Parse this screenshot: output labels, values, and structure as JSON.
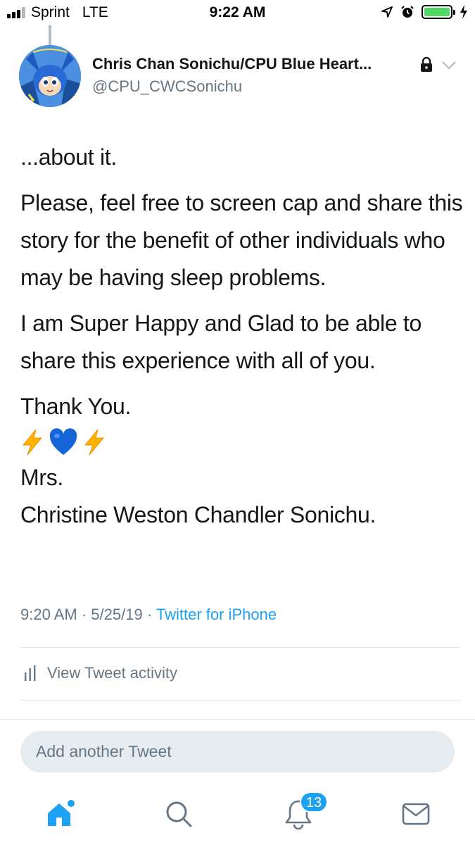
{
  "status_bar": {
    "carrier": "Sprint",
    "network": "LTE",
    "time": "9:22 AM",
    "battery_level": 1.0,
    "battery_color": "#4cd964"
  },
  "tweet": {
    "author_name": "Chris Chan Sonichu/CPU Blue Heart...",
    "author_handle": "@CPU_CWCSonichu",
    "avatar_icon": "avatar-icon",
    "paragraphs": {
      "p1": "...about it.",
      "p2": "Please, feel free to screen cap and share this story for the benefit of other individuals who may be having sleep problems.",
      "p3": "I am Super Happy and Glad to be able to share this experience with all of you.",
      "p4_line1": "Thank You.",
      "p4_emoji": [
        "high-voltage-emoji",
        "blue-heart-emoji",
        "high-voltage-emoji"
      ],
      "p4_line2": "Mrs.",
      "p4_line3": "Christine Weston Chandler Sonichu."
    },
    "timestamp_time": "9:20 AM",
    "timestamp_date": "5/25/19",
    "separator": "·",
    "source": "Twitter for iPhone"
  },
  "activity": {
    "label": "View Tweet activity",
    "icon": "bar-chart-icon"
  },
  "reply": {
    "placeholder": "Add another Tweet"
  },
  "tab_bar": {
    "items": [
      "home-icon",
      "search-icon",
      "notifications-icon",
      "messages-icon"
    ],
    "notifications_badge": "13",
    "active_color": "#1da1f2",
    "inactive_color": "#657786"
  }
}
